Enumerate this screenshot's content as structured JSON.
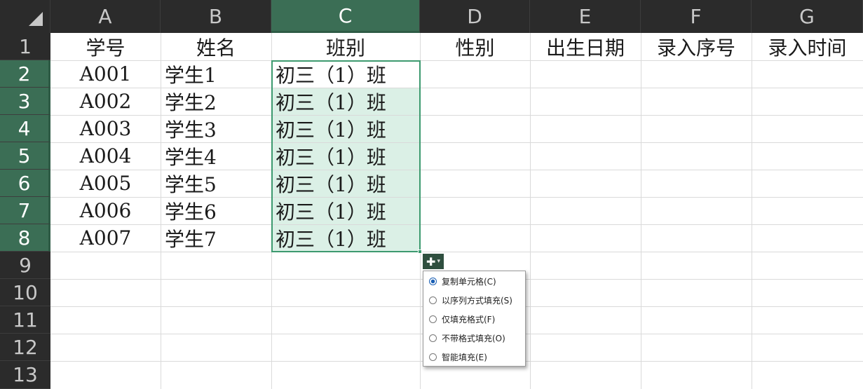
{
  "column_headers": [
    "A",
    "B",
    "C",
    "D",
    "E",
    "F",
    "G"
  ],
  "row_headers": [
    "1",
    "2",
    "3",
    "4",
    "5",
    "6",
    "7",
    "8",
    "9",
    "10",
    "11",
    "12",
    "13"
  ],
  "header_row": [
    "学号",
    "姓名",
    "班别",
    "性别",
    "出生日期",
    "录入序号",
    "录入时间"
  ],
  "rows": [
    [
      "A001",
      "学生1",
      "初三（1）班"
    ],
    [
      "A002",
      "学生2",
      "初三（1）班"
    ],
    [
      "A003",
      "学生3",
      "初三（1）班"
    ],
    [
      "A004",
      "学生4",
      "初三（1）班"
    ],
    [
      "A005",
      "学生5",
      "初三（1）班"
    ],
    [
      "A006",
      "学生6",
      "初三（1）班"
    ],
    [
      "A007",
      "学生7",
      "初三（1）班"
    ]
  ],
  "selected_column": "C",
  "autofill_menu": {
    "items": [
      "复制单元格(C)",
      "以序列方式填充(S)",
      "仅填充格式(F)",
      "不带格式填充(O)",
      "智能填充(E)"
    ],
    "selected_index": 0
  },
  "colors": {
    "selection_accent": "#3d9a6f",
    "header_bg": "#2b2b2b",
    "selected_header_bg": "#3b6e55"
  }
}
